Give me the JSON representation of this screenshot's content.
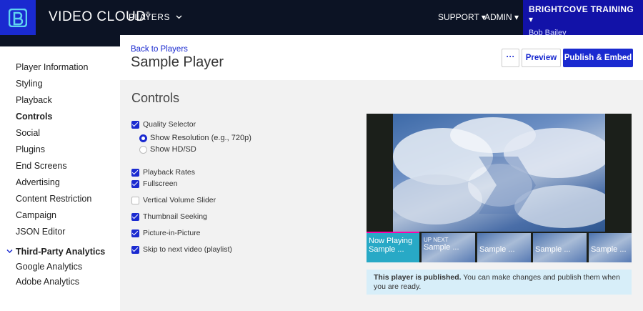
{
  "app": {
    "brand": "VIDEO CLOUD",
    "brand_mark": "®",
    "nav_players": "PLAYERS",
    "nav_support": "SUPPORT",
    "nav_admin": "ADMIN",
    "account_name": "BRIGHTCOVE TRAINING",
    "account_user": "Bob Bailey"
  },
  "sidebar": {
    "items": [
      {
        "label": "Player Information"
      },
      {
        "label": "Styling"
      },
      {
        "label": "Playback"
      },
      {
        "label": "Controls"
      },
      {
        "label": "Social"
      },
      {
        "label": "Plugins"
      },
      {
        "label": "End Screens"
      },
      {
        "label": "Advertising"
      },
      {
        "label": "Content Restriction"
      },
      {
        "label": "Campaign"
      },
      {
        "label": "JSON Editor"
      },
      {
        "label": "Third-Party Analytics"
      },
      {
        "label": "Google Analytics"
      },
      {
        "label": "Adobe Analytics"
      }
    ]
  },
  "header": {
    "back_link": "Back to Players",
    "title": "Sample Player",
    "more_label": "···",
    "preview_label": "Preview",
    "publish_label": "Publish & Embed"
  },
  "controls": {
    "title": "Controls",
    "quality_selector": "Quality Selector",
    "show_resolution": "Show Resolution (e.g., 720p)",
    "show_hdsd": "Show HD/SD",
    "playback_rates": "Playback Rates",
    "fullscreen": "Fullscreen",
    "vertical_volume": "Vertical Volume Slider",
    "thumbnail_seeking": "Thumbnail Seeking",
    "picture_in_picture": "Picture-in-Picture",
    "skip_next": "Skip to next video (playlist)"
  },
  "player": {
    "now_playing": "Now Playing",
    "up_next": "UP NEXT",
    "sample": "Sample ..."
  },
  "notice": {
    "bold": "This player is published.",
    "text": " You can make changes and publish them when you are ready."
  },
  "colors": {
    "accent": "#1a2ad0",
    "topbar": "#0c1324",
    "account_bg": "#1212a8",
    "notice_bg": "#d7eef9",
    "now_playing_bg": "#28a9c6",
    "progress": "#ff00aa"
  }
}
